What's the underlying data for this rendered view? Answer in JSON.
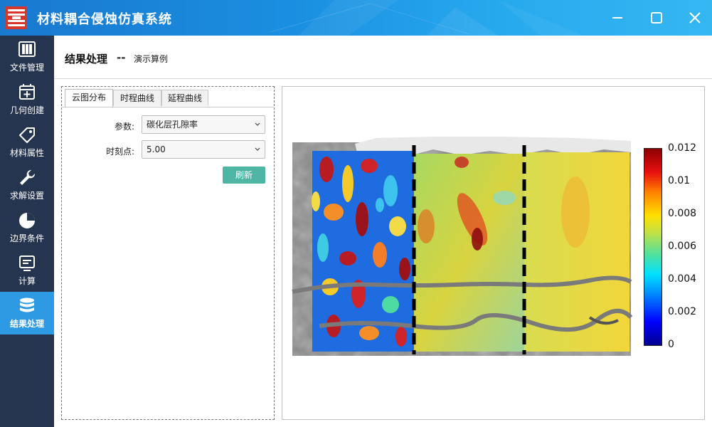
{
  "window": {
    "title": "材料耦合侵蚀仿真系统"
  },
  "sidebar": {
    "items": [
      {
        "label": "文件管理",
        "icon": "file-manage-icon"
      },
      {
        "label": "几何创建",
        "icon": "geometry-create-icon"
      },
      {
        "label": "材料属性",
        "icon": "tag-icon"
      },
      {
        "label": "求解设置",
        "icon": "wrench-icon"
      },
      {
        "label": "边界条件",
        "icon": "pie-chart-icon"
      },
      {
        "label": "计算",
        "icon": "monitor-icon"
      },
      {
        "label": "结果处理",
        "icon": "database-icon",
        "active": true
      }
    ]
  },
  "header": {
    "title": "结果处理",
    "separator": "--",
    "subtitle": "演示算例"
  },
  "left_panel": {
    "tabs": [
      {
        "label": "云图分布",
        "active": true
      },
      {
        "label": "时程曲线"
      },
      {
        "label": "延程曲线"
      }
    ],
    "param_label": "参数:",
    "param_value": "碳化层孔隙率",
    "time_label": "时刻点:",
    "time_value": "5.00",
    "refresh_label": "刷新"
  },
  "colorbar": {
    "ticks": [
      "0.012",
      "0.01",
      "0.008",
      "0.006",
      "0.004",
      "0.002",
      "0"
    ],
    "min": 0,
    "max": 0.012
  },
  "colors": {
    "titlebar": "#1a8ee0",
    "sidebar": "#26354f",
    "sidebar_active": "#2d9ae3",
    "refresh_button": "#4fb6a6"
  }
}
